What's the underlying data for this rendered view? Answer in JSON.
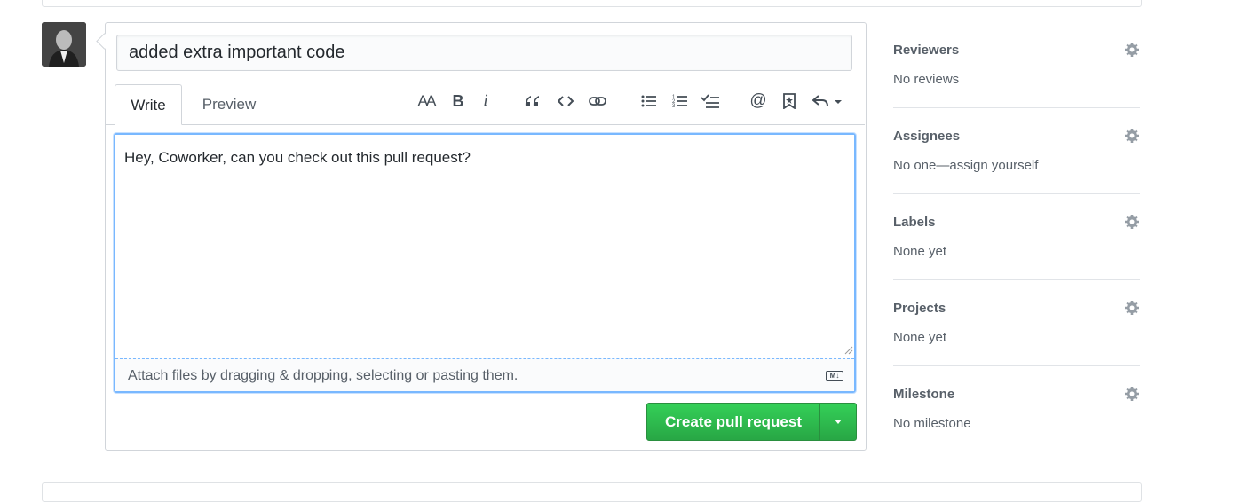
{
  "pr": {
    "title_value": "added extra important code",
    "tabs": [
      "Write",
      "Preview"
    ],
    "body_value": "Hey, Coworker, can you check out this pull request?",
    "attach_hint": "Attach files by dragging & dropping, selecting or pasting them.",
    "markdown_badge": "M↓",
    "submit_label": "Create pull request"
  },
  "toolbar": {
    "icons": [
      "text-size-icon",
      "bold-icon",
      "italic-icon",
      "quote-icon",
      "code-icon",
      "link-icon",
      "unordered-list-icon",
      "ordered-list-icon",
      "task-list-icon",
      "mention-icon",
      "saved-reply-icon",
      "reply-icon"
    ],
    "heading": "AA",
    "bold": "B",
    "italic": "i",
    "mention": "@"
  },
  "sidebar": {
    "reviewers": {
      "title": "Reviewers",
      "value": "No reviews"
    },
    "assignees": {
      "title": "Assignees",
      "value_prefix": "No one—",
      "value_link": "assign yourself"
    },
    "labels": {
      "title": "Labels",
      "value": "None yet"
    },
    "projects": {
      "title": "Projects",
      "value": "None yet"
    },
    "milestone": {
      "title": "Milestone",
      "value": "No milestone"
    }
  },
  "colors": {
    "primary_button": "#28a745",
    "focus_border": "#79b8ff",
    "muted_text": "#586069"
  }
}
